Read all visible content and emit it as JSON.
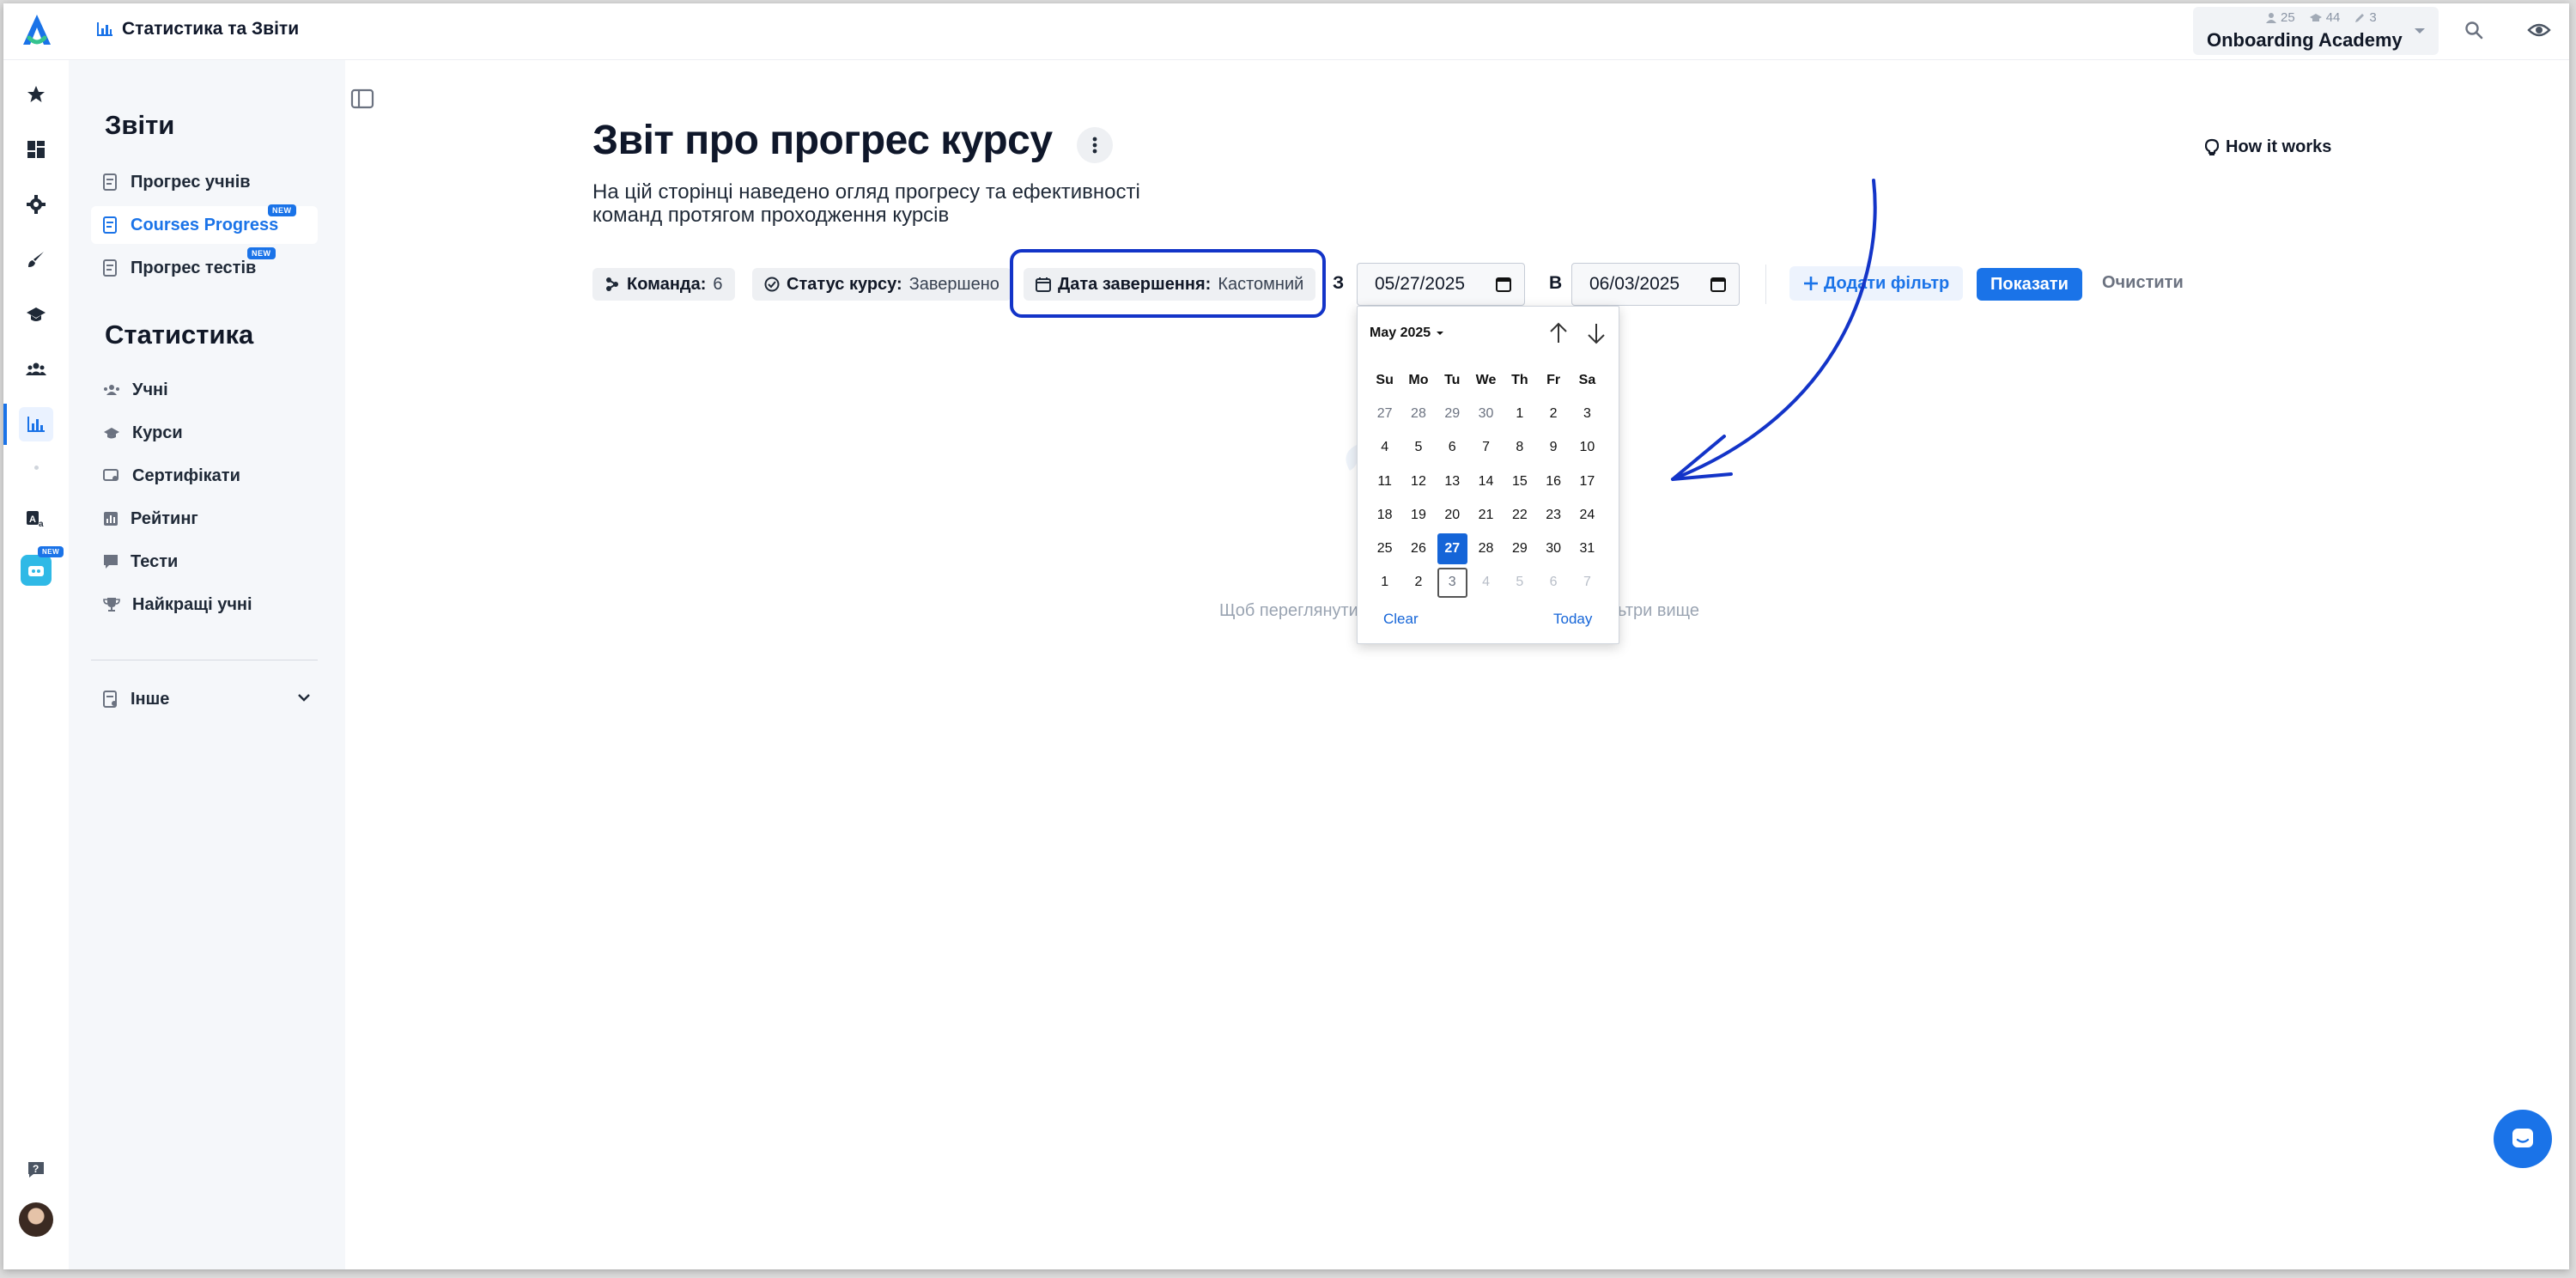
{
  "topbar": {
    "breadcrumb": "Статистика та Звіти",
    "org": {
      "name": "Onboarding Academy",
      "stat_users": "25",
      "stat_courses": "44",
      "stat_authors": "3"
    }
  },
  "sidebar": {
    "reports_title": "Звіти",
    "reports_items": [
      {
        "label": "Прогрес учнів"
      },
      {
        "label": "Courses Progress",
        "badge": "NEW"
      },
      {
        "label": "Прогрес тестів",
        "badge": "NEW"
      }
    ],
    "stats_title": "Статистика",
    "stats_items": [
      {
        "label": "Учні"
      },
      {
        "label": "Курси"
      },
      {
        "label": "Сертифікати"
      },
      {
        "label": "Рейтинг"
      },
      {
        "label": "Тести"
      },
      {
        "label": "Найкращі учні"
      }
    ],
    "other_label": "Інше",
    "rail_badge": "NEW"
  },
  "main": {
    "title": "Звіт про прогрес курсу",
    "subtitle": "На цій сторінці наведено огляд прогресу та ефективності команд протягом проходження курсів",
    "how_it_works": "How it works",
    "filters": {
      "team_label": "Команда:",
      "team_value": "6",
      "status_label": "Статус курсу:",
      "status_value": "Завершено",
      "date_label": "Дата завершення:",
      "date_value": "Кастомний",
      "from_label": "З",
      "from_value": "05/27/2025",
      "to_label": "В",
      "to_value": "06/03/2025",
      "add_filter": "Додати фільтр",
      "show": "Показати",
      "clear": "Очистити"
    },
    "empty_left": "Щоб переглянути",
    "empty_right": "ьтри вище"
  },
  "calendar": {
    "month_label": "May 2025",
    "weekdays": [
      "Su",
      "Mo",
      "Tu",
      "We",
      "Th",
      "Fr",
      "Sa"
    ],
    "weeks": [
      [
        "27",
        "28",
        "29",
        "30",
        "1",
        "2",
        "3"
      ],
      [
        "4",
        "5",
        "6",
        "7",
        "8",
        "9",
        "10"
      ],
      [
        "11",
        "12",
        "13",
        "14",
        "15",
        "16",
        "17"
      ],
      [
        "18",
        "19",
        "20",
        "21",
        "22",
        "23",
        "24"
      ],
      [
        "25",
        "26",
        "27",
        "28",
        "29",
        "30",
        "31"
      ],
      [
        "1",
        "2",
        "3",
        "4",
        "5",
        "6",
        "7"
      ]
    ],
    "selected_day": "27",
    "today_day": "3",
    "clear": "Clear",
    "today": "Today"
  },
  "colors": {
    "accent": "#1a73e8",
    "annotation": "#1334c8"
  }
}
